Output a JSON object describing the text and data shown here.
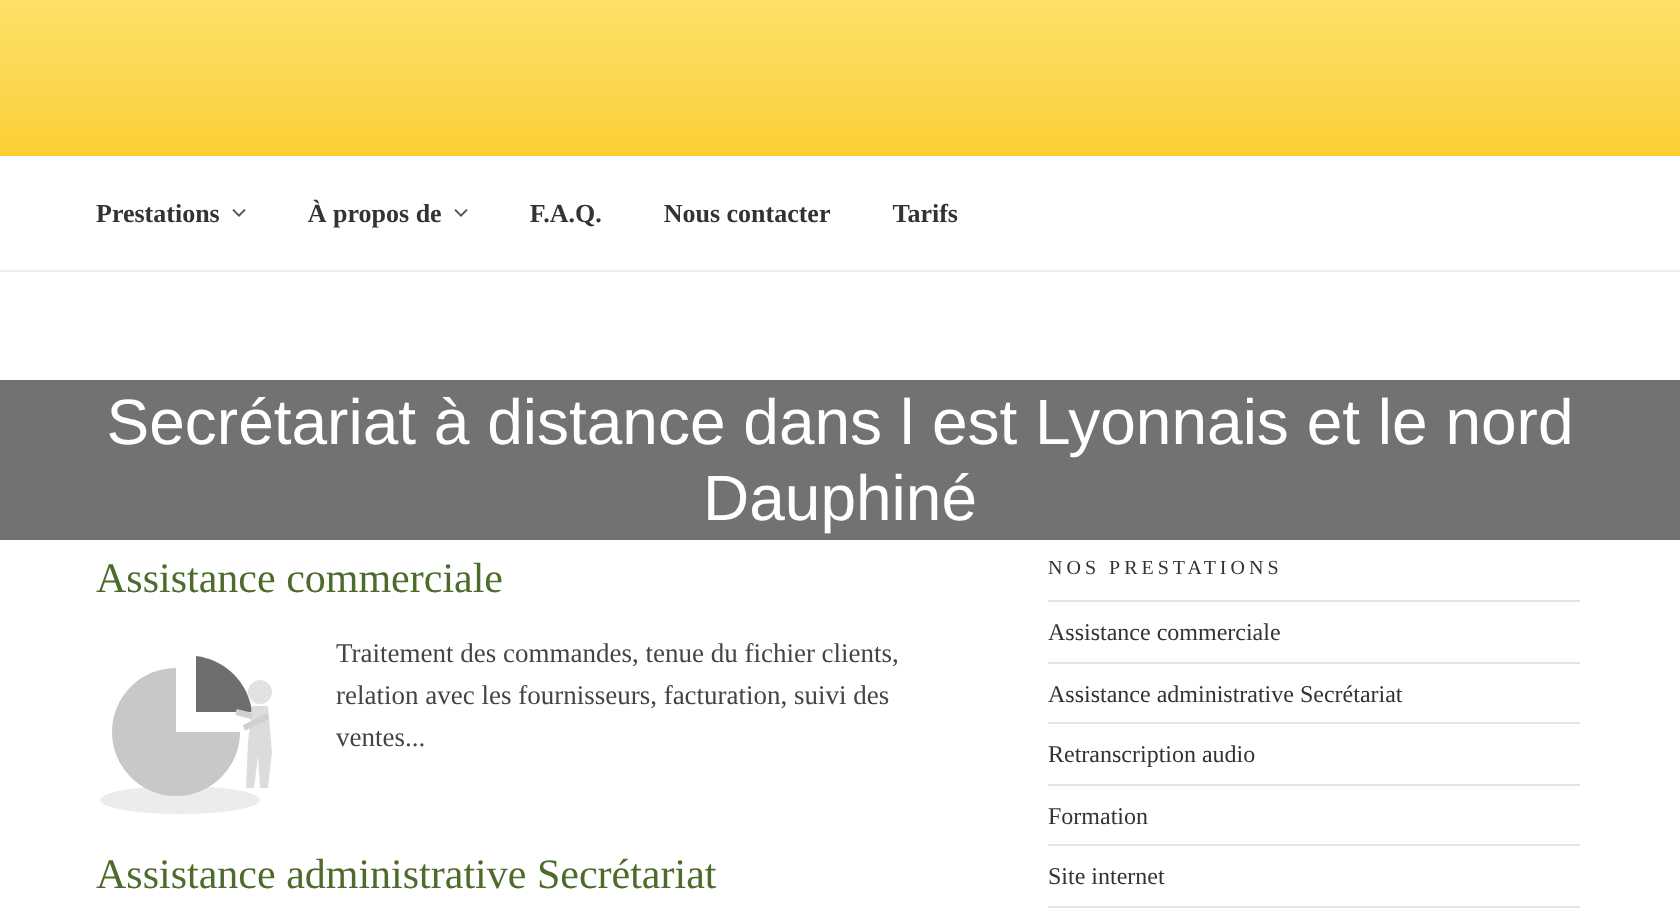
{
  "nav": {
    "items": [
      {
        "label": "Prestations",
        "dropdown": true
      },
      {
        "label": "À propos de",
        "dropdown": true
      },
      {
        "label": "F.A.Q.",
        "dropdown": false
      },
      {
        "label": "Nous contacter",
        "dropdown": false
      },
      {
        "label": "Tarifs",
        "dropdown": false
      }
    ]
  },
  "banner": {
    "title": "Secrétariat à distance dans l est Lyonnais et le nord Dauphiné"
  },
  "posts": [
    {
      "title": "Assistance commerciale",
      "excerpt": "Traitement des commandes, tenue du fichier clients, relation avec les fournisseurs, facturation, suivi des ventes..."
    },
    {
      "title": "Assistance administrative Secrétariat"
    }
  ],
  "sidebar": {
    "heading": "NOS PRESTATIONS",
    "items": [
      "Assistance commerciale",
      "Assistance administrative Secrétariat",
      "Retranscription audio",
      "Formation",
      "Site internet"
    ]
  }
}
